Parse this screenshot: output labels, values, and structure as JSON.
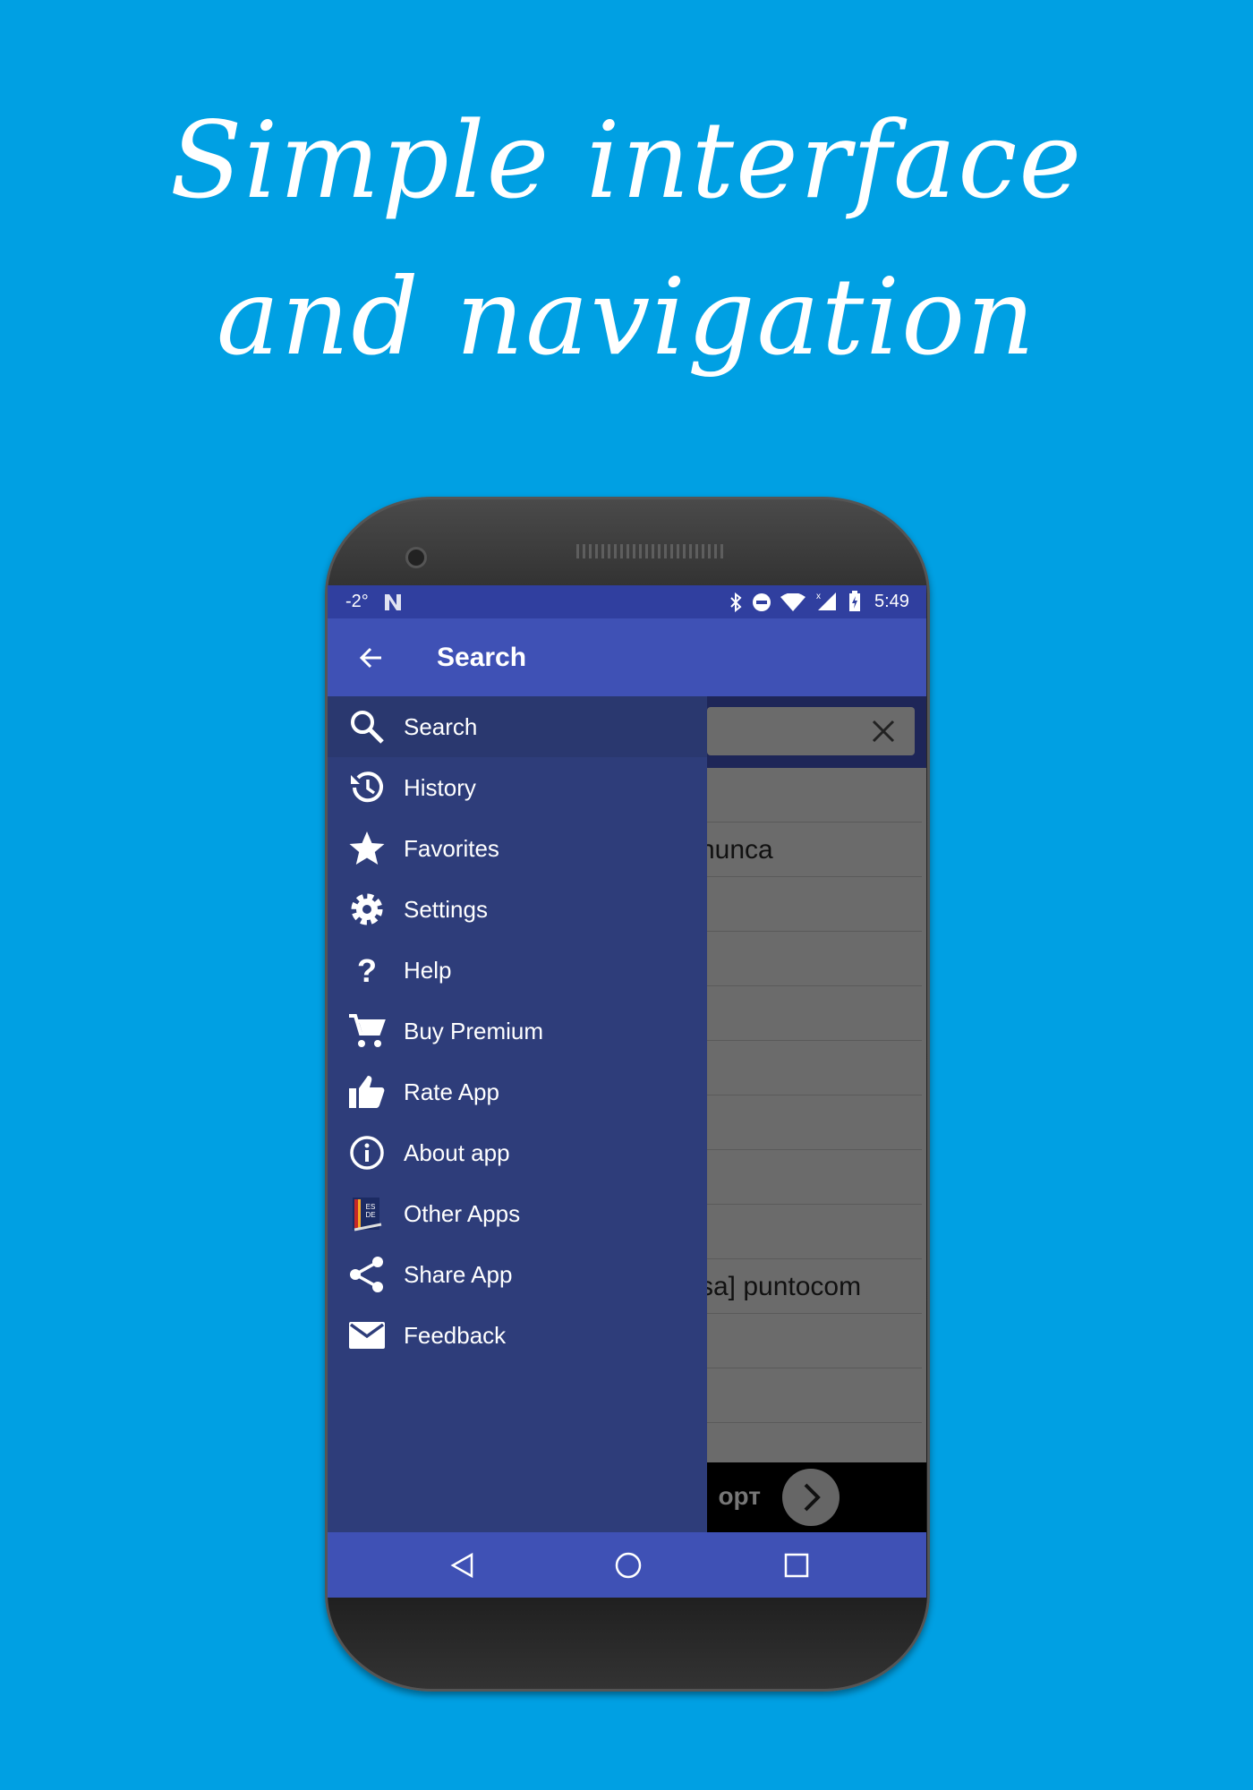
{
  "headline": {
    "line1": "Simple interface",
    "line2": "and navigation"
  },
  "status_bar": {
    "temperature": "-2°",
    "time": "5:49",
    "icons": [
      "n-icon",
      "bluetooth-icon",
      "do-not-disturb-icon",
      "wifi-icon",
      "signal-icon",
      "battery-charging-icon"
    ]
  },
  "app_bar": {
    "title": "Search",
    "back_icon": "arrow-left-icon"
  },
  "drawer": {
    "items": [
      {
        "label": "Search",
        "icon": "search-icon"
      },
      {
        "label": "History",
        "icon": "history-icon"
      },
      {
        "label": "Favorites",
        "icon": "star-icon"
      },
      {
        "label": "Settings",
        "icon": "gear-icon"
      },
      {
        "label": "Help",
        "icon": "question-icon"
      },
      {
        "label": "Buy Premium",
        "icon": "cart-icon"
      },
      {
        "label": "Rate App",
        "icon": "thumbs-up-icon"
      },
      {
        "label": "About app",
        "icon": "info-icon"
      },
      {
        "label": "Other Apps",
        "icon": "dictionary-app-icon"
      },
      {
        "label": "Share App",
        "icon": "share-icon"
      },
      {
        "label": "Feedback",
        "icon": "mail-icon"
      }
    ]
  },
  "content": {
    "rows": [
      "",
      "nunca",
      "",
      "",
      "",
      "",
      "",
      "",
      "",
      "sa] puntocom",
      "",
      ""
    ],
    "ad_text": "орт"
  },
  "colors": {
    "background": "#00a0e3",
    "status_bar": "#303f9f",
    "app_bar": "#3f51b5",
    "drawer": "#2e3d7a"
  }
}
